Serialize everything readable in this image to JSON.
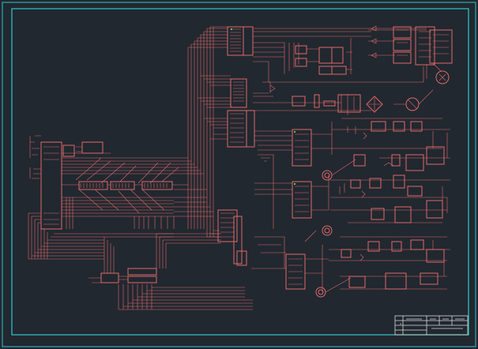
{
  "drawing": {
    "type": "circuit-schematic",
    "line_color": "#e06868",
    "frame_color": "#30c6cc",
    "background": "#212830",
    "title_block_color": "#d8d8d8"
  },
  "icons": [
    "motor-icon",
    "bridge-rectifier-icon",
    "relay-icon",
    "potentiometer-icon"
  ]
}
